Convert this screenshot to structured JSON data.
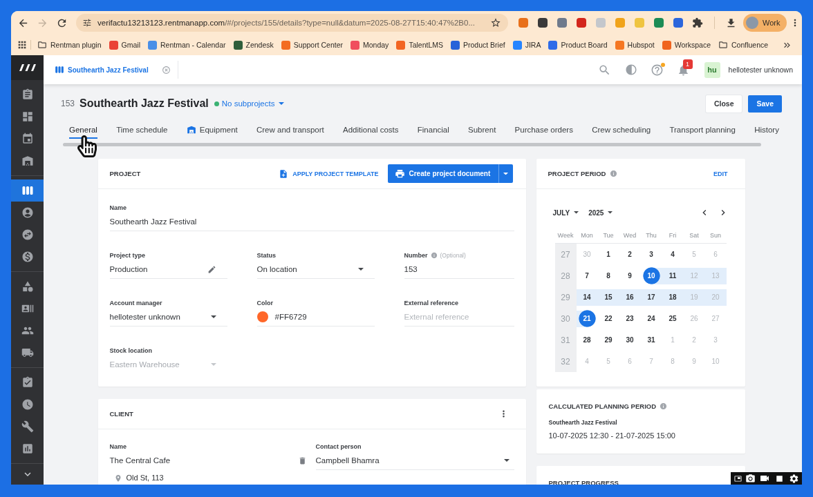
{
  "browser": {
    "nav": {
      "back_disabled": false,
      "forward_disabled": true
    },
    "url_host": "verifactu13213123.rentmanapp.com",
    "url_path": "/#/projects/155/details?type=null&datum=2025-08-27T15:40:47%2B0...",
    "extensions": [
      {
        "color": "#e8701a"
      },
      {
        "color": "#3a3a3a"
      },
      {
        "color": "#6f7a8c"
      },
      {
        "color": "#d3261c"
      },
      {
        "color": "#c4c7cc"
      },
      {
        "color": "#f0a31a"
      },
      {
        "color": "#efc440"
      },
      {
        "color": "#1c8c55"
      },
      {
        "color": "#2b66dc"
      }
    ],
    "profile": "Work",
    "bookmarks": [
      {
        "label": "Rentman plugin",
        "kind": "folder"
      },
      {
        "label": "Gmail",
        "kind": "site",
        "color": "#ea4335"
      },
      {
        "label": "Rentman - Calendar",
        "kind": "site",
        "color": "#4a8fe7"
      },
      {
        "label": "Zendesk",
        "kind": "site",
        "color": "#2f5e3b"
      },
      {
        "label": "Support Center",
        "kind": "site",
        "color": "#f36c21"
      },
      {
        "label": "Monday",
        "kind": "site",
        "color": "#f04e5e"
      },
      {
        "label": "TalentLMS",
        "kind": "site",
        "color": "#f26522"
      },
      {
        "label": "Product Brief",
        "kind": "site",
        "color": "#2762d9"
      },
      {
        "label": "JIRA",
        "kind": "site",
        "color": "#2684ff"
      },
      {
        "label": "Product Board",
        "kind": "site",
        "color": "#2f6be8"
      },
      {
        "label": "Hubspot",
        "kind": "site",
        "color": "#f57722"
      },
      {
        "label": "Workspace",
        "kind": "site",
        "color": "#f0641e"
      },
      {
        "label": "Confluence",
        "kind": "folder"
      }
    ]
  },
  "sidebar": {
    "sections": [
      {
        "items": [
          {
            "selected": false
          },
          {
            "selected": false
          },
          {
            "selected": false
          },
          {
            "selected": false
          }
        ]
      },
      {
        "items": [
          {
            "selected": true
          },
          {
            "selected": false
          },
          {
            "selected": false
          },
          {
            "selected": false
          }
        ]
      },
      {
        "items": [
          {
            "selected": false
          },
          {
            "selected": false
          },
          {
            "selected": false
          },
          {
            "selected": false
          }
        ]
      },
      {
        "items": [
          {
            "selected": false
          },
          {
            "selected": false
          },
          {
            "selected": false
          },
          {
            "selected": false
          }
        ]
      }
    ]
  },
  "header": {
    "project_tab": "Southearth Jazz Festival",
    "help_unread": true,
    "notification_count": "1",
    "user_initials": "hu",
    "user_name": "hellotester unknown"
  },
  "project": {
    "number": "153",
    "name": "Southearth Jazz Festival",
    "subprojects": "No subprojects",
    "actions": [
      {
        "label": "Close",
        "kind": "secondary"
      },
      {
        "label": "Save",
        "kind": "primary"
      }
    ]
  },
  "tabs": [
    {
      "label": "General",
      "selected": true,
      "kind": "text"
    },
    {
      "label": "Time schedule",
      "selected": false,
      "kind": "text"
    },
    {
      "label": "Equipment",
      "selected": false,
      "kind": "icon"
    },
    {
      "label": "Crew and transport",
      "selected": false,
      "kind": "text"
    },
    {
      "label": "Additional costs",
      "selected": false,
      "kind": "text"
    },
    {
      "label": "Financial",
      "selected": false,
      "kind": "text"
    },
    {
      "label": "Subrent",
      "selected": false,
      "kind": "text"
    },
    {
      "label": "Purchase orders",
      "selected": false,
      "kind": "text"
    },
    {
      "label": "Crew scheduling",
      "selected": false,
      "kind": "text"
    },
    {
      "label": "Transport planning",
      "selected": false,
      "kind": "text"
    },
    {
      "label": "History",
      "selected": false,
      "kind": "text"
    }
  ],
  "project_card": {
    "title": "PROJECT",
    "template_link": "APPLY PROJECT TEMPLATE",
    "document_button": "Create project document",
    "name_field": {
      "label": "Name",
      "value": "Southearth Jazz Festival",
      "kind": "text",
      "disabled": false,
      "info": false
    },
    "fields": [
      {
        "label": "Project type",
        "value": "Production",
        "kind": "edit",
        "disabled": false,
        "info": false
      },
      {
        "label": "Status",
        "value": "On location",
        "kind": "select",
        "disabled": false,
        "info": false
      },
      {
        "label": "Number",
        "hint": "(Optional)",
        "value": "153",
        "kind": "text",
        "disabled": false,
        "info": true
      },
      {
        "label": "Account manager",
        "value": "hellotester unknown",
        "kind": "select",
        "disabled": false,
        "info": false
      },
      {
        "label": "Color",
        "value": "#FF6729",
        "color": "#ff6729",
        "kind": "color",
        "disabled": false,
        "info": false
      },
      {
        "label": "External reference",
        "placeholder": "External reference",
        "kind": "text",
        "disabled": false,
        "info": false
      },
      {
        "label": "Stock location",
        "value": "Eastern Warehouse",
        "kind": "select",
        "disabled": true,
        "info": false
      }
    ]
  },
  "client_card": {
    "title": "CLIENT",
    "fields": [
      {
        "label": "Name",
        "value": "The Central Cafe",
        "kind": "delete"
      },
      {
        "label": "Contact person",
        "value": "Campbell Bhamra",
        "kind": "select"
      }
    ],
    "address": "Old St, 113"
  },
  "period_card": {
    "title": "PROJECT PERIOD",
    "edit": "EDIT",
    "month": "JULY",
    "year": "2025",
    "weekdays": [
      "Week",
      "Mon",
      "Tue",
      "Wed",
      "Thu",
      "Fri",
      "Sat",
      "Sun"
    ],
    "weeks": [
      {
        "number": "27",
        "days": [
          {
            "label": "30",
            "muted": true,
            "selected": false,
            "in_range": false
          },
          {
            "label": "1",
            "muted": false,
            "selected": false,
            "in_range": false
          },
          {
            "label": "2",
            "muted": false,
            "selected": false,
            "in_range": false
          },
          {
            "label": "3",
            "muted": false,
            "selected": false,
            "in_range": false
          },
          {
            "label": "4",
            "muted": false,
            "selected": false,
            "in_range": false
          },
          {
            "label": "5",
            "muted": true,
            "selected": false,
            "in_range": false
          },
          {
            "label": "6",
            "muted": true,
            "selected": false,
            "in_range": false
          }
        ]
      },
      {
        "number": "28",
        "days": [
          {
            "label": "7",
            "muted": false,
            "selected": false,
            "in_range": false
          },
          {
            "label": "8",
            "muted": false,
            "selected": false,
            "in_range": false
          },
          {
            "label": "9",
            "muted": false,
            "selected": false,
            "in_range": false
          },
          {
            "label": "10",
            "muted": false,
            "selected": true,
            "in_range": true
          },
          {
            "label": "11",
            "muted": false,
            "selected": false,
            "in_range": true
          },
          {
            "label": "12",
            "muted": true,
            "selected": false,
            "in_range": true
          },
          {
            "label": "13",
            "muted": true,
            "selected": false,
            "in_range": true
          }
        ]
      },
      {
        "number": "29",
        "days": [
          {
            "label": "14",
            "muted": false,
            "selected": false,
            "in_range": true
          },
          {
            "label": "15",
            "muted": false,
            "selected": false,
            "in_range": true
          },
          {
            "label": "16",
            "muted": false,
            "selected": false,
            "in_range": true
          },
          {
            "label": "17",
            "muted": false,
            "selected": false,
            "in_range": true
          },
          {
            "label": "18",
            "muted": false,
            "selected": false,
            "in_range": true
          },
          {
            "label": "19",
            "muted": true,
            "selected": false,
            "in_range": true
          },
          {
            "label": "20",
            "muted": true,
            "selected": false,
            "in_range": true
          }
        ]
      },
      {
        "number": "30",
        "days": [
          {
            "label": "21",
            "muted": false,
            "selected": true,
            "in_range": true
          },
          {
            "label": "22",
            "muted": false,
            "selected": false,
            "in_range": false
          },
          {
            "label": "23",
            "muted": false,
            "selected": false,
            "in_range": false
          },
          {
            "label": "24",
            "muted": false,
            "selected": false,
            "in_range": false
          },
          {
            "label": "25",
            "muted": false,
            "selected": false,
            "in_range": false
          },
          {
            "label": "26",
            "muted": true,
            "selected": false,
            "in_range": false
          },
          {
            "label": "27",
            "muted": true,
            "selected": false,
            "in_range": false
          }
        ]
      },
      {
        "number": "31",
        "days": [
          {
            "label": "28",
            "muted": false,
            "selected": false,
            "in_range": false
          },
          {
            "label": "29",
            "muted": false,
            "selected": false,
            "in_range": false
          },
          {
            "label": "30",
            "muted": false,
            "selected": false,
            "in_range": false
          },
          {
            "label": "31",
            "muted": false,
            "selected": false,
            "in_range": false
          },
          {
            "label": "1",
            "muted": true,
            "selected": false,
            "in_range": false
          },
          {
            "label": "2",
            "muted": true,
            "selected": false,
            "in_range": false
          },
          {
            "label": "3",
            "muted": true,
            "selected": false,
            "in_range": false
          }
        ]
      },
      {
        "number": "32",
        "days": [
          {
            "label": "4",
            "muted": true,
            "selected": false,
            "in_range": false
          },
          {
            "label": "5",
            "muted": true,
            "selected": false,
            "in_range": false
          },
          {
            "label": "6",
            "muted": true,
            "selected": false,
            "in_range": false
          },
          {
            "label": "7",
            "muted": true,
            "selected": false,
            "in_range": false
          },
          {
            "label": "8",
            "muted": true,
            "selected": false,
            "in_range": false
          },
          {
            "label": "9",
            "muted": true,
            "selected": false,
            "in_range": false
          },
          {
            "label": "10",
            "muted": true,
            "selected": false,
            "in_range": false
          }
        ]
      }
    ]
  },
  "calculated_card": {
    "title": "CALCULATED PLANNING PERIOD",
    "project": "Southearth Jazz Festival",
    "period": "10-07-2025 12:30 - 21-07-2025 15:00"
  },
  "progress_card": {
    "title": "PROJECT PROGRESS"
  }
}
